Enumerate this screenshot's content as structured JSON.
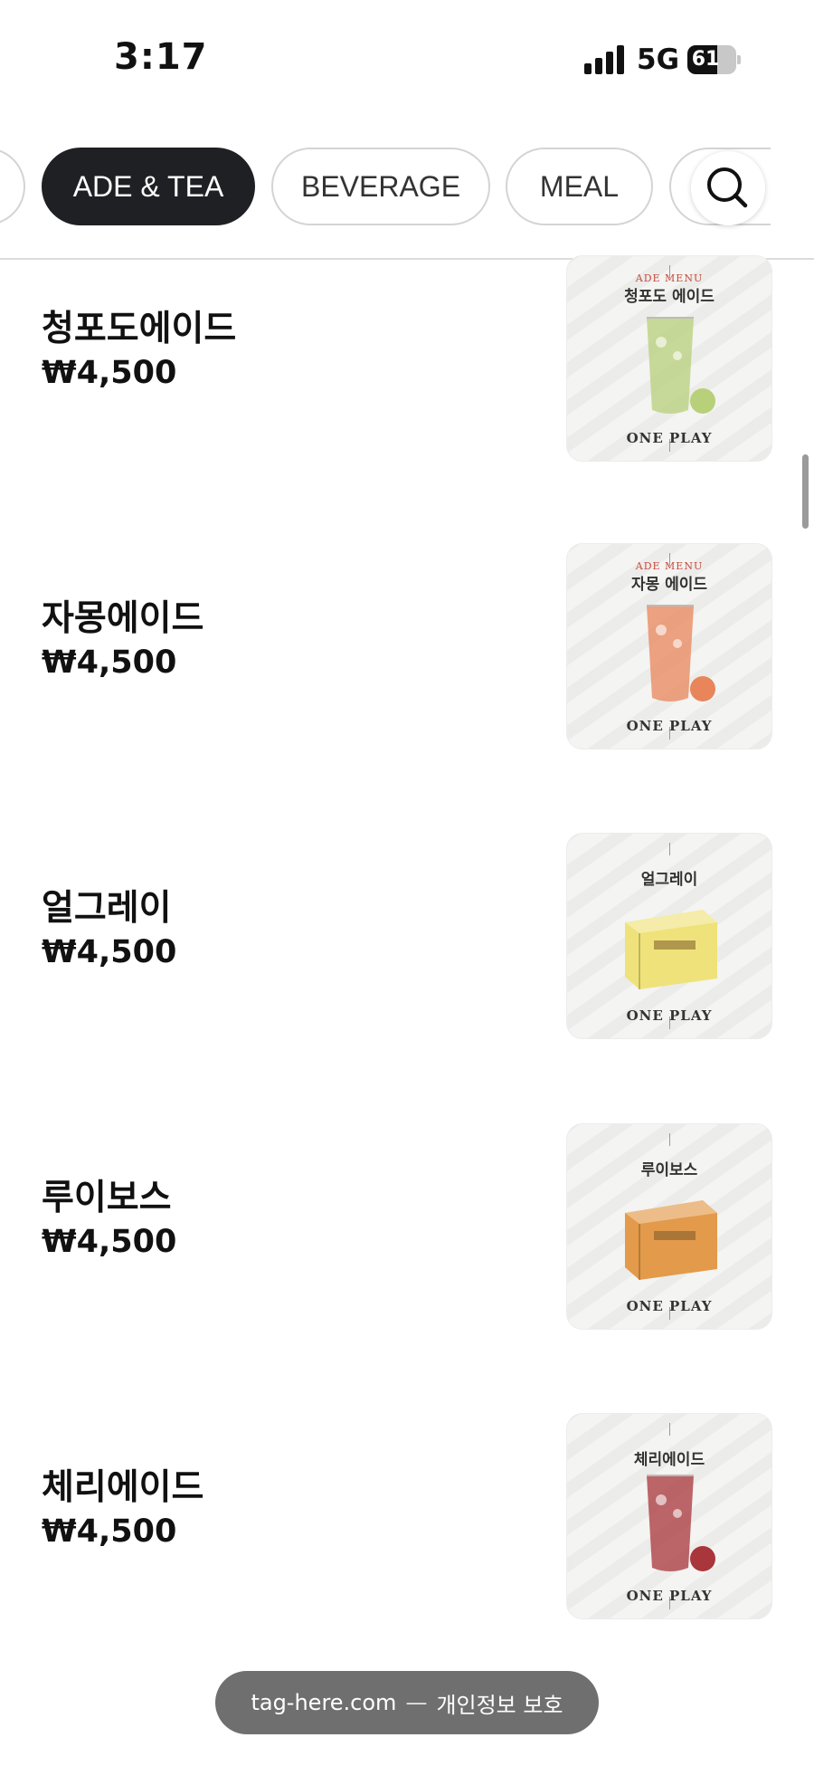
{
  "status_bar": {
    "time": "3:17",
    "network": "5G",
    "battery": "61",
    "battery_fill": 0.61
  },
  "nav": {
    "partial_left_label": "",
    "categories": [
      {
        "label": "ADE & TEA",
        "active": true
      },
      {
        "label": "BEVERAGE",
        "active": false
      },
      {
        "label": "MEAL",
        "active": false
      }
    ],
    "search_icon": "search-icon"
  },
  "menu": [
    {
      "name": "청포도에이드",
      "price": "₩4,500",
      "image": {
        "tag": "ADE MENU",
        "title": "청포도 에이드",
        "brand": "ONE PLAY",
        "accent": "#b8d07a",
        "kind": "ade"
      }
    },
    {
      "name": "자몽에이드",
      "price": "₩4,500",
      "image": {
        "tag": "ADE MENU",
        "title": "자몽 에이드",
        "brand": "ONE PLAY",
        "accent": "#e9855a",
        "kind": "ade"
      }
    },
    {
      "name": "얼그레이",
      "price": "₩4,500",
      "image": {
        "tag": "",
        "title": "얼그레이",
        "brand": "ONE PLAY",
        "accent": "#efe27a",
        "kind": "tea"
      }
    },
    {
      "name": "루이보스",
      "price": "₩4,500",
      "image": {
        "tag": "",
        "title": "루이보스",
        "brand": "ONE PLAY",
        "accent": "#e39a4a",
        "kind": "tea"
      }
    },
    {
      "name": "체리에이드",
      "price": "₩4,500",
      "image": {
        "tag": "",
        "title": "체리에이드",
        "brand": "ONE PLAY",
        "accent": "#a8363a",
        "kind": "ade"
      }
    }
  ],
  "footer": {
    "site": "tag-here.com",
    "separator": "—",
    "privacy": "개인정보 보호"
  }
}
